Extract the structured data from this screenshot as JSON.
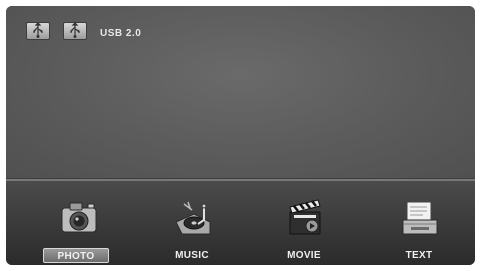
{
  "header": {
    "source_label": "USB 2.0",
    "devices": [
      {
        "icon": "usb-drive-icon"
      },
      {
        "icon": "usb-drive-icon"
      }
    ]
  },
  "menu": {
    "items": [
      {
        "label": "PHOTO",
        "icon": "camera-icon",
        "selected": true
      },
      {
        "label": "MUSIC",
        "icon": "turntable-icon",
        "selected": false
      },
      {
        "label": "MOVIE",
        "icon": "clapperboard-icon",
        "selected": false
      },
      {
        "label": "TEXT",
        "icon": "document-tray-icon",
        "selected": false
      }
    ]
  }
}
